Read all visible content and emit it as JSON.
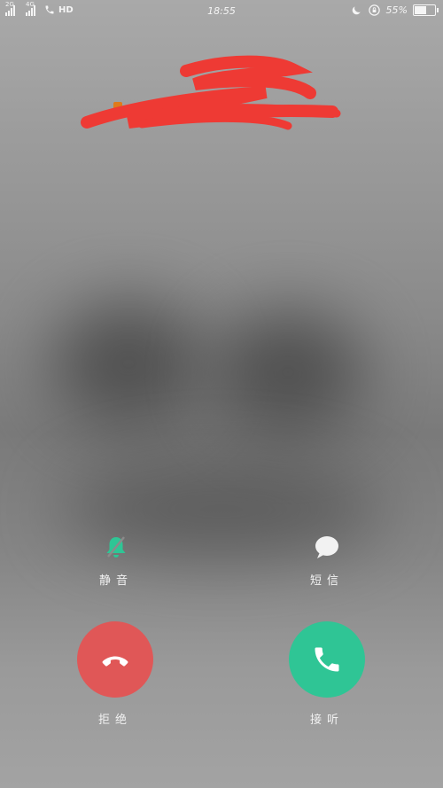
{
  "status_bar": {
    "sim1_label": "2G",
    "sim2_label": "4G",
    "hd_label": "HD",
    "time": "18:55",
    "battery_text": "55%"
  },
  "caller": {
    "redacted": true
  },
  "actions": {
    "mute_label": "静音",
    "message_label": "短信",
    "decline_label": "拒绝",
    "answer_label": "接听"
  },
  "colors": {
    "decline": "#e05757",
    "answer": "#2fc595",
    "mute_icon": "#2fc595",
    "redaction": "#ee3a34"
  },
  "icons": {
    "mute": "bell-off-icon",
    "message": "chat-bubble-icon",
    "decline": "phone-hangup-icon",
    "answer": "phone-icon",
    "moon": "moon-icon",
    "rotation_lock": "rotation-lock-icon",
    "battery": "battery-icon"
  }
}
